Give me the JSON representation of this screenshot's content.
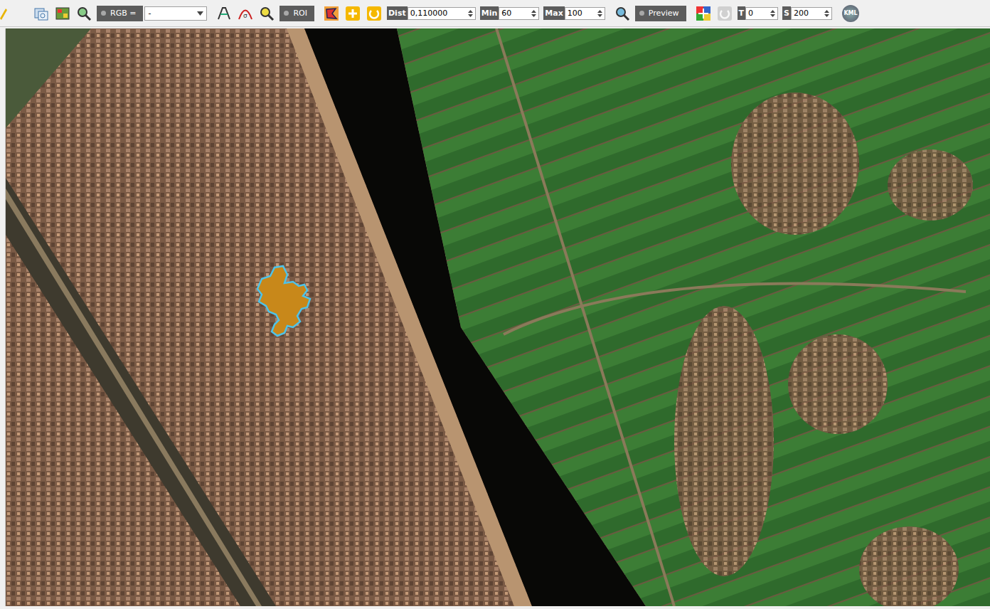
{
  "toolbar": {
    "rgb": {
      "label": "RGB =",
      "value": "-",
      "checked": false
    },
    "roi": {
      "label": "ROI",
      "checked": false
    },
    "dist": {
      "label": "Dist",
      "value": "0,110000"
    },
    "min": {
      "label": "Min",
      "value": "60"
    },
    "max": {
      "label": "Max",
      "value": "100"
    },
    "preview": {
      "label": "Preview",
      "checked": false
    },
    "redo": {
      "disabled": true
    },
    "t": {
      "label": "T",
      "value": "0"
    },
    "s": {
      "label": "S",
      "value": "200"
    },
    "kml": {
      "label": "KML"
    }
  },
  "map": {
    "roi_shown": true
  }
}
